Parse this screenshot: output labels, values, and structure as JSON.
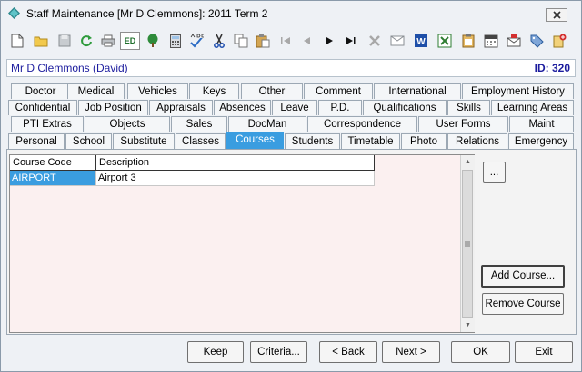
{
  "window": {
    "title": "Staff Maintenance  [Mr D Clemmons]:  2011 Term 2",
    "close_icon": "close-icon"
  },
  "toolbar": {
    "icons": [
      "new-document-icon",
      "open-folder-icon",
      "save-disk-icon",
      "refresh-icon",
      "print-icon",
      "edit-ed-icon",
      "tree-icon",
      "calculator-icon",
      "spellcheck-icon",
      "cut-icon",
      "copy-icon",
      "paste-icon",
      "first-record-icon",
      "previous-record-icon",
      "next-record-icon",
      "last-record-icon",
      "delete-icon",
      "mail-icon",
      "word-icon",
      "excel-icon",
      "clipboard-icon",
      "calendar-icon",
      "email-send-icon",
      "tag-icon",
      "note-add-icon"
    ],
    "edit_label": "ED"
  },
  "staff": {
    "name": "Mr D Clemmons (David)",
    "id": "ID: 320"
  },
  "tabs": {
    "row1": [
      "Doctor",
      "Medical",
      "Vehicles",
      "Keys",
      "Other",
      "Comment",
      "International",
      "Employment History"
    ],
    "row2": [
      "Confidential",
      "Job Position",
      "Appraisals",
      "Absences",
      "Leave",
      "P.D.",
      "Qualifications",
      "Skills",
      "Learning Areas"
    ],
    "row3": [
      "PTI Extras",
      "Objects",
      "Sales",
      "DocMan",
      "Correspondence",
      "User Forms",
      "Maint"
    ],
    "row4": [
      "Personal",
      "School",
      "Substitute",
      "Classes",
      "Courses",
      "Students",
      "Timetable",
      "Photo",
      "Relations",
      "Emergency"
    ],
    "active": "Courses"
  },
  "grid": {
    "columns": [
      "Course Code",
      "Description"
    ],
    "rows": [
      {
        "code": "AIRPORT",
        "description": "Airport 3"
      }
    ]
  },
  "buttons": {
    "ellipsis": "...",
    "add_course": "Add Course...",
    "remove_course": "Remove Course"
  },
  "footer": {
    "keep": "Keep",
    "criteria": "Criteria...",
    "back": "< Back",
    "next": "Next >",
    "ok": "OK",
    "exit": "Exit"
  },
  "colors": {
    "active_tab": "#3a9de0",
    "grid_background": "#fbf0f0",
    "selected_row": "#3a9de0",
    "staff_text": "#1c1c9e"
  }
}
